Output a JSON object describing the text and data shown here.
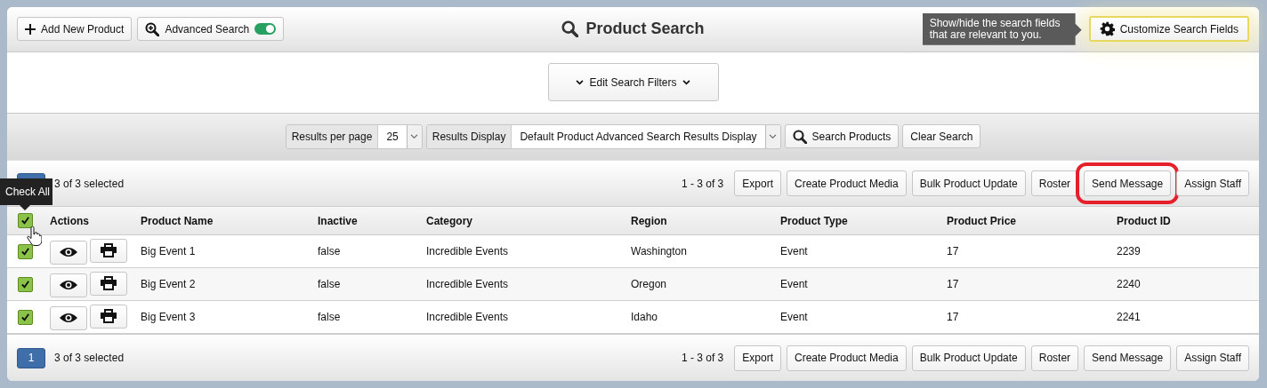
{
  "header": {
    "buttons": [
      {
        "kind": "add",
        "label": "Add New Product"
      },
      {
        "kind": "advanced",
        "label": "Advanced Search",
        "toggle_on": true
      }
    ],
    "title": "Product Search",
    "tooltip": "Show/hide the search fields that are relevant to you.",
    "customize_button": "Customize Search Fields"
  },
  "filters_button": "Edit Search Filters",
  "toolbar": {
    "results_per_page": {
      "label": "Results per page",
      "value": "25"
    },
    "results_display": {
      "label": "Results Display",
      "value": "Default Product Advanced Search Results Display"
    },
    "search_button": "Search Products",
    "clear_button": "Clear Search"
  },
  "pager_top": {
    "selected_count": "3 of 3 selected",
    "range": "1 - 3 of 3",
    "actions": [
      {
        "label": "Export",
        "highlighted": false
      },
      {
        "label": "Create Product Media",
        "highlighted": false
      },
      {
        "label": "Bulk Product Update",
        "highlighted": false
      },
      {
        "label": "Roster",
        "highlighted": false
      },
      {
        "label": "Send Message",
        "highlighted": true
      },
      {
        "label": "Assign Staff",
        "highlighted": false
      }
    ]
  },
  "check_all_tooltip": "Check All",
  "table": {
    "all_checked": true,
    "actions_header": "Actions",
    "columns": [
      "Product Name",
      "Inactive",
      "Category",
      "Region",
      "Product Type",
      "Product Price",
      "Product ID"
    ],
    "rows": [
      {
        "checked": true,
        "cells": [
          "Big Event 1",
          "false",
          "Incredible Events",
          "Washington",
          "Event",
          "17",
          "2239"
        ]
      },
      {
        "checked": true,
        "cells": [
          "Big Event 2",
          "false",
          "Incredible Events",
          "Oregon",
          "Event",
          "17",
          "2240"
        ]
      },
      {
        "checked": true,
        "cells": [
          "Big Event 3",
          "false",
          "Incredible Events",
          "Idaho",
          "Event",
          "17",
          "2241"
        ]
      }
    ]
  },
  "pager_bottom": {
    "page": "1",
    "selected_count": "3 of 3 selected",
    "range": "1 - 3 of 3",
    "actions": [
      {
        "label": "Export",
        "highlighted": false
      },
      {
        "label": "Create Product Media",
        "highlighted": false
      },
      {
        "label": "Bulk Product Update",
        "highlighted": false
      },
      {
        "label": "Roster",
        "highlighted": false
      },
      {
        "label": "Send Message",
        "highlighted": false
      },
      {
        "label": "Assign Staff",
        "highlighted": false
      }
    ]
  }
}
